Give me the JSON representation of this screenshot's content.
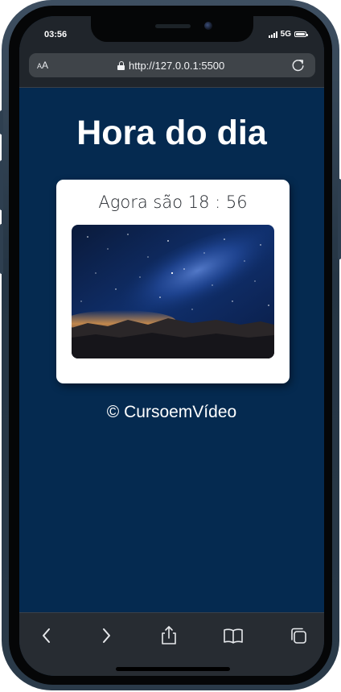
{
  "status": {
    "time": "03:56",
    "network": "5G"
  },
  "browser": {
    "aa_label_small": "A",
    "aa_label_large": "A",
    "url": "http://127.0.0.1:5500",
    "icons": [
      "lock-icon",
      "reload-icon"
    ]
  },
  "page": {
    "title": "Hora do dia",
    "message": "Agora são 18 : 56",
    "image_alt": "night-sky",
    "footer": "© CursoemVídeo"
  },
  "toolbar": {
    "icons": [
      "back-icon",
      "forward-icon",
      "share-icon",
      "bookmarks-icon",
      "tabs-icon"
    ]
  },
  "colors": {
    "page_background": "#052a50",
    "card_background": "#ffffff",
    "browser_chrome": "#20252b"
  }
}
